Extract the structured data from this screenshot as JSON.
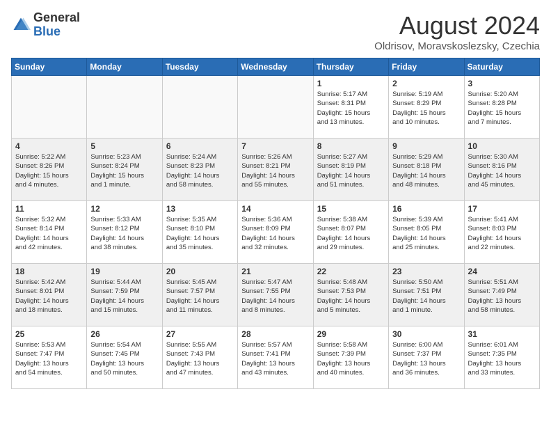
{
  "logo": {
    "general": "General",
    "blue": "Blue"
  },
  "title": {
    "month_year": "August 2024",
    "location": "Oldrisov, Moravskoslezsky, Czechia"
  },
  "days_of_week": [
    "Sunday",
    "Monday",
    "Tuesday",
    "Wednesday",
    "Thursday",
    "Friday",
    "Saturday"
  ],
  "weeks": [
    [
      {
        "day": "",
        "info": ""
      },
      {
        "day": "",
        "info": ""
      },
      {
        "day": "",
        "info": ""
      },
      {
        "day": "",
        "info": ""
      },
      {
        "day": "1",
        "info": "Sunrise: 5:17 AM\nSunset: 8:31 PM\nDaylight: 15 hours\nand 13 minutes."
      },
      {
        "day": "2",
        "info": "Sunrise: 5:19 AM\nSunset: 8:29 PM\nDaylight: 15 hours\nand 10 minutes."
      },
      {
        "day": "3",
        "info": "Sunrise: 5:20 AM\nSunset: 8:28 PM\nDaylight: 15 hours\nand 7 minutes."
      }
    ],
    [
      {
        "day": "4",
        "info": "Sunrise: 5:22 AM\nSunset: 8:26 PM\nDaylight: 15 hours\nand 4 minutes."
      },
      {
        "day": "5",
        "info": "Sunrise: 5:23 AM\nSunset: 8:24 PM\nDaylight: 15 hours\nand 1 minute."
      },
      {
        "day": "6",
        "info": "Sunrise: 5:24 AM\nSunset: 8:23 PM\nDaylight: 14 hours\nand 58 minutes."
      },
      {
        "day": "7",
        "info": "Sunrise: 5:26 AM\nSunset: 8:21 PM\nDaylight: 14 hours\nand 55 minutes."
      },
      {
        "day": "8",
        "info": "Sunrise: 5:27 AM\nSunset: 8:19 PM\nDaylight: 14 hours\nand 51 minutes."
      },
      {
        "day": "9",
        "info": "Sunrise: 5:29 AM\nSunset: 8:18 PM\nDaylight: 14 hours\nand 48 minutes."
      },
      {
        "day": "10",
        "info": "Sunrise: 5:30 AM\nSunset: 8:16 PM\nDaylight: 14 hours\nand 45 minutes."
      }
    ],
    [
      {
        "day": "11",
        "info": "Sunrise: 5:32 AM\nSunset: 8:14 PM\nDaylight: 14 hours\nand 42 minutes."
      },
      {
        "day": "12",
        "info": "Sunrise: 5:33 AM\nSunset: 8:12 PM\nDaylight: 14 hours\nand 38 minutes."
      },
      {
        "day": "13",
        "info": "Sunrise: 5:35 AM\nSunset: 8:10 PM\nDaylight: 14 hours\nand 35 minutes."
      },
      {
        "day": "14",
        "info": "Sunrise: 5:36 AM\nSunset: 8:09 PM\nDaylight: 14 hours\nand 32 minutes."
      },
      {
        "day": "15",
        "info": "Sunrise: 5:38 AM\nSunset: 8:07 PM\nDaylight: 14 hours\nand 29 minutes."
      },
      {
        "day": "16",
        "info": "Sunrise: 5:39 AM\nSunset: 8:05 PM\nDaylight: 14 hours\nand 25 minutes."
      },
      {
        "day": "17",
        "info": "Sunrise: 5:41 AM\nSunset: 8:03 PM\nDaylight: 14 hours\nand 22 minutes."
      }
    ],
    [
      {
        "day": "18",
        "info": "Sunrise: 5:42 AM\nSunset: 8:01 PM\nDaylight: 14 hours\nand 18 minutes."
      },
      {
        "day": "19",
        "info": "Sunrise: 5:44 AM\nSunset: 7:59 PM\nDaylight: 14 hours\nand 15 minutes."
      },
      {
        "day": "20",
        "info": "Sunrise: 5:45 AM\nSunset: 7:57 PM\nDaylight: 14 hours\nand 11 minutes."
      },
      {
        "day": "21",
        "info": "Sunrise: 5:47 AM\nSunset: 7:55 PM\nDaylight: 14 hours\nand 8 minutes."
      },
      {
        "day": "22",
        "info": "Sunrise: 5:48 AM\nSunset: 7:53 PM\nDaylight: 14 hours\nand 5 minutes."
      },
      {
        "day": "23",
        "info": "Sunrise: 5:50 AM\nSunset: 7:51 PM\nDaylight: 14 hours\nand 1 minute."
      },
      {
        "day": "24",
        "info": "Sunrise: 5:51 AM\nSunset: 7:49 PM\nDaylight: 13 hours\nand 58 minutes."
      }
    ],
    [
      {
        "day": "25",
        "info": "Sunrise: 5:53 AM\nSunset: 7:47 PM\nDaylight: 13 hours\nand 54 minutes."
      },
      {
        "day": "26",
        "info": "Sunrise: 5:54 AM\nSunset: 7:45 PM\nDaylight: 13 hours\nand 50 minutes."
      },
      {
        "day": "27",
        "info": "Sunrise: 5:55 AM\nSunset: 7:43 PM\nDaylight: 13 hours\nand 47 minutes."
      },
      {
        "day": "28",
        "info": "Sunrise: 5:57 AM\nSunset: 7:41 PM\nDaylight: 13 hours\nand 43 minutes."
      },
      {
        "day": "29",
        "info": "Sunrise: 5:58 AM\nSunset: 7:39 PM\nDaylight: 13 hours\nand 40 minutes."
      },
      {
        "day": "30",
        "info": "Sunrise: 6:00 AM\nSunset: 7:37 PM\nDaylight: 13 hours\nand 36 minutes."
      },
      {
        "day": "31",
        "info": "Sunrise: 6:01 AM\nSunset: 7:35 PM\nDaylight: 13 hours\nand 33 minutes."
      }
    ]
  ]
}
